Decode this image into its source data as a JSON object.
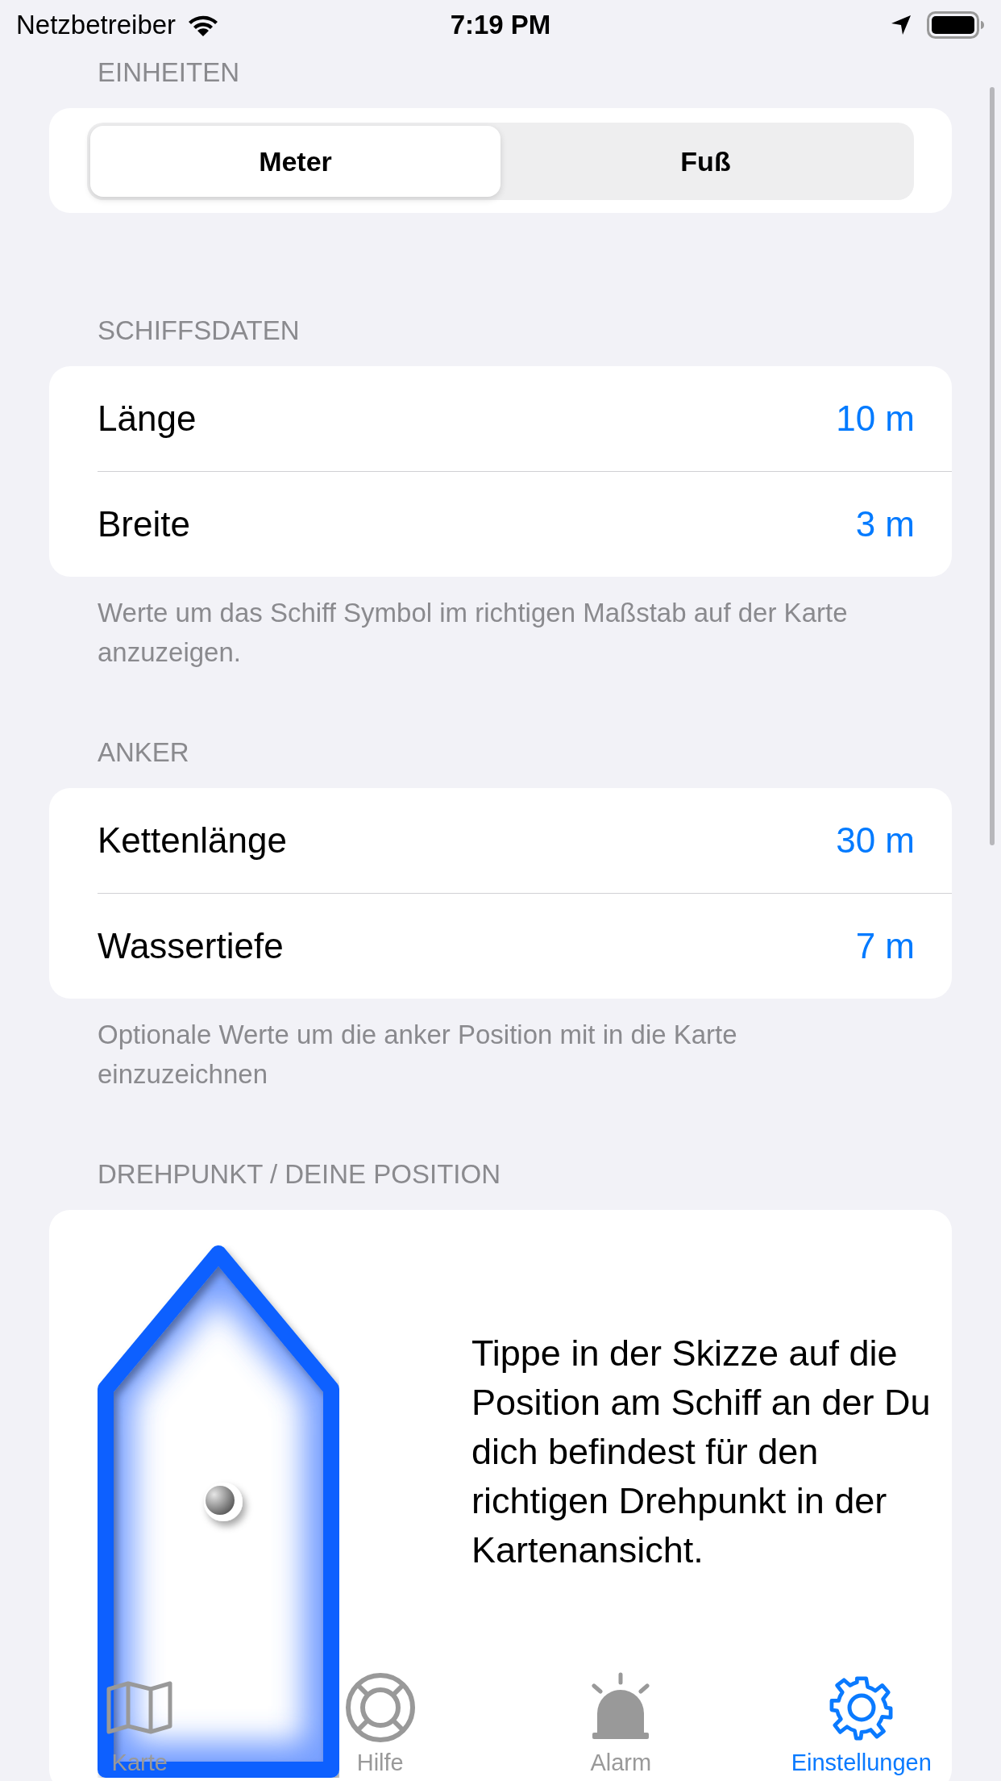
{
  "status_bar": {
    "carrier": "Netzbetreiber",
    "time": "7:19 PM"
  },
  "sections": [
    {
      "kind": "segmented",
      "header": "EINHEITEN",
      "segments": [
        {
          "label": "Meter",
          "selected": true
        },
        {
          "label": "Fuß",
          "selected": false
        }
      ]
    },
    {
      "kind": "rows",
      "header": "SCHIFFSDATEN",
      "rows": [
        {
          "label": "Länge",
          "value": "10 m"
        },
        {
          "label": "Breite",
          "value": "3 m"
        }
      ],
      "footer": "Werte um das Schiff Symbol im richtigen Maßstab auf der Karte anzuzeigen."
    },
    {
      "kind": "rows",
      "header": "ANKER",
      "rows": [
        {
          "label": "Kettenlänge",
          "value": "30 m"
        },
        {
          "label": "Wassertiefe",
          "value": "7 m"
        }
      ],
      "footer": "Optionale Werte um die anker Position mit in die Karte einzuzeichnen"
    },
    {
      "kind": "pivot",
      "header": "DREHPUNKT / DEINE POSITION",
      "instruction": "Tippe in der Skizze auf die Position am Schiff an der Du dich befindest für den richtigen Drehpunkt in der Kartenansicht."
    }
  ],
  "tab_bar": [
    {
      "label": "Karte",
      "selected": false
    },
    {
      "label": "Hilfe",
      "selected": false
    },
    {
      "label": "Alarm",
      "selected": false
    },
    {
      "label": "Einstellungen",
      "selected": true
    }
  ]
}
